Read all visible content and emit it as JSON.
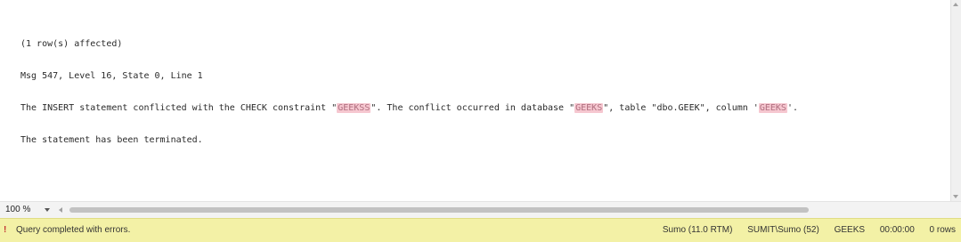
{
  "messages": {
    "line1": "(1 row(s) affected)",
    "line2": "Msg 547, Level 16, State 0, Line 1",
    "line3_pre": "The INSERT statement conflicted with the CHECK constraint \"",
    "line3_r1": "GEEKSS",
    "line3_mid1": "\". The conflict occurred in database \"",
    "line3_r2": "GEEKS",
    "line3_mid2": "\", table \"dbo.GEEK\", column '",
    "line3_r3": "GEEKS",
    "line3_end": "'.",
    "line4": "The statement has been terminated."
  },
  "zoom": {
    "value": "100 %"
  },
  "status": {
    "icon": "error-warning-icon",
    "text": "Query completed with errors.",
    "server": "Sumo (11.0 RTM)",
    "login": "SUMIT\\Sumo (52)",
    "database": "GEEKS",
    "elapsed": "00:00:00",
    "rows": "0 rows"
  }
}
